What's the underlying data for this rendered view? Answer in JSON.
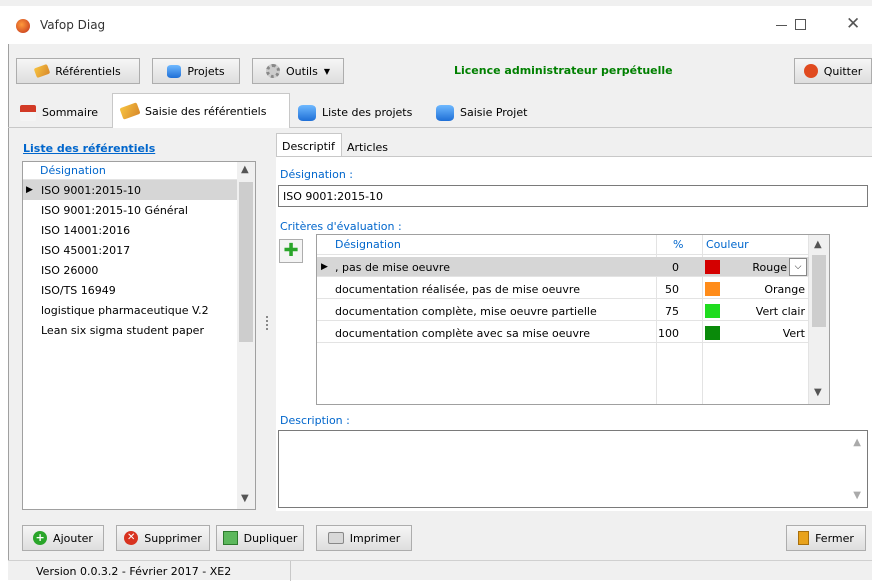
{
  "window": {
    "title": "Vafop Diag"
  },
  "toolbar": {
    "referentiels_label": "Référentiels",
    "projets_label": "Projets",
    "outils_label": "Outils",
    "license_text": "Licence administrateur perpétuelle",
    "quitter_label": "Quitter"
  },
  "tabs": [
    {
      "label": "Sommaire"
    },
    {
      "label": "Saisie des référentiels"
    },
    {
      "label": "Liste des projets"
    },
    {
      "label": "Saisie Projet"
    }
  ],
  "left": {
    "title": "Liste des référentiels",
    "col_header": "Désignation",
    "items": [
      {
        "label": "ISO 9001:2015-10"
      },
      {
        "label": "ISO 9001:2015-10 Général"
      },
      {
        "label": "ISO 14001:2016"
      },
      {
        "label": "ISO 45001:2017"
      },
      {
        "label": "ISO 26000"
      },
      {
        "label": "ISO/TS 16949"
      },
      {
        "label": "logistique pharmaceutique V.2"
      },
      {
        "label": "Lean six sigma student paper"
      }
    ]
  },
  "detail": {
    "subtabs": [
      {
        "label": "Descriptif"
      },
      {
        "label": "Articles"
      }
    ],
    "designation_label": "Désignation :",
    "designation_value": "ISO 9001:2015-10",
    "criteres_label": "Critères d'évaluation :",
    "grid": {
      "headers": {
        "designation": "Désignation",
        "pct": "%",
        "couleur": "Couleur"
      },
      "rows": [
        {
          "designation": ", pas de mise oeuvre",
          "pct": "0",
          "color_hex": "#d40000",
          "color_name": "Rouge"
        },
        {
          "designation": "documentation réalisée, pas de mise oeuvre",
          "pct": "50",
          "color_hex": "#ff8c1a",
          "color_name": "Orange"
        },
        {
          "designation": "documentation complète, mise oeuvre partielle",
          "pct": "75",
          "color_hex": "#1fdc1f",
          "color_name": "Vert clair"
        },
        {
          "designation": "documentation complète avec sa mise oeuvre",
          "pct": "100",
          "color_hex": "#0a8a0a",
          "color_name": "Vert"
        }
      ]
    },
    "description_label": "Description :"
  },
  "bottom": {
    "ajouter_label": "Ajouter",
    "supprimer_label": "Supprimer",
    "dupliquer_label": "Dupliquer",
    "imprimer_label": "Imprimer",
    "fermer_label": "Fermer"
  },
  "status": {
    "version": "Version 0.0.3.2 - Février 2017 - XE2"
  },
  "colors": {
    "accent": "#0066cc",
    "license": "#008000",
    "selection": "#d6d6d6"
  }
}
